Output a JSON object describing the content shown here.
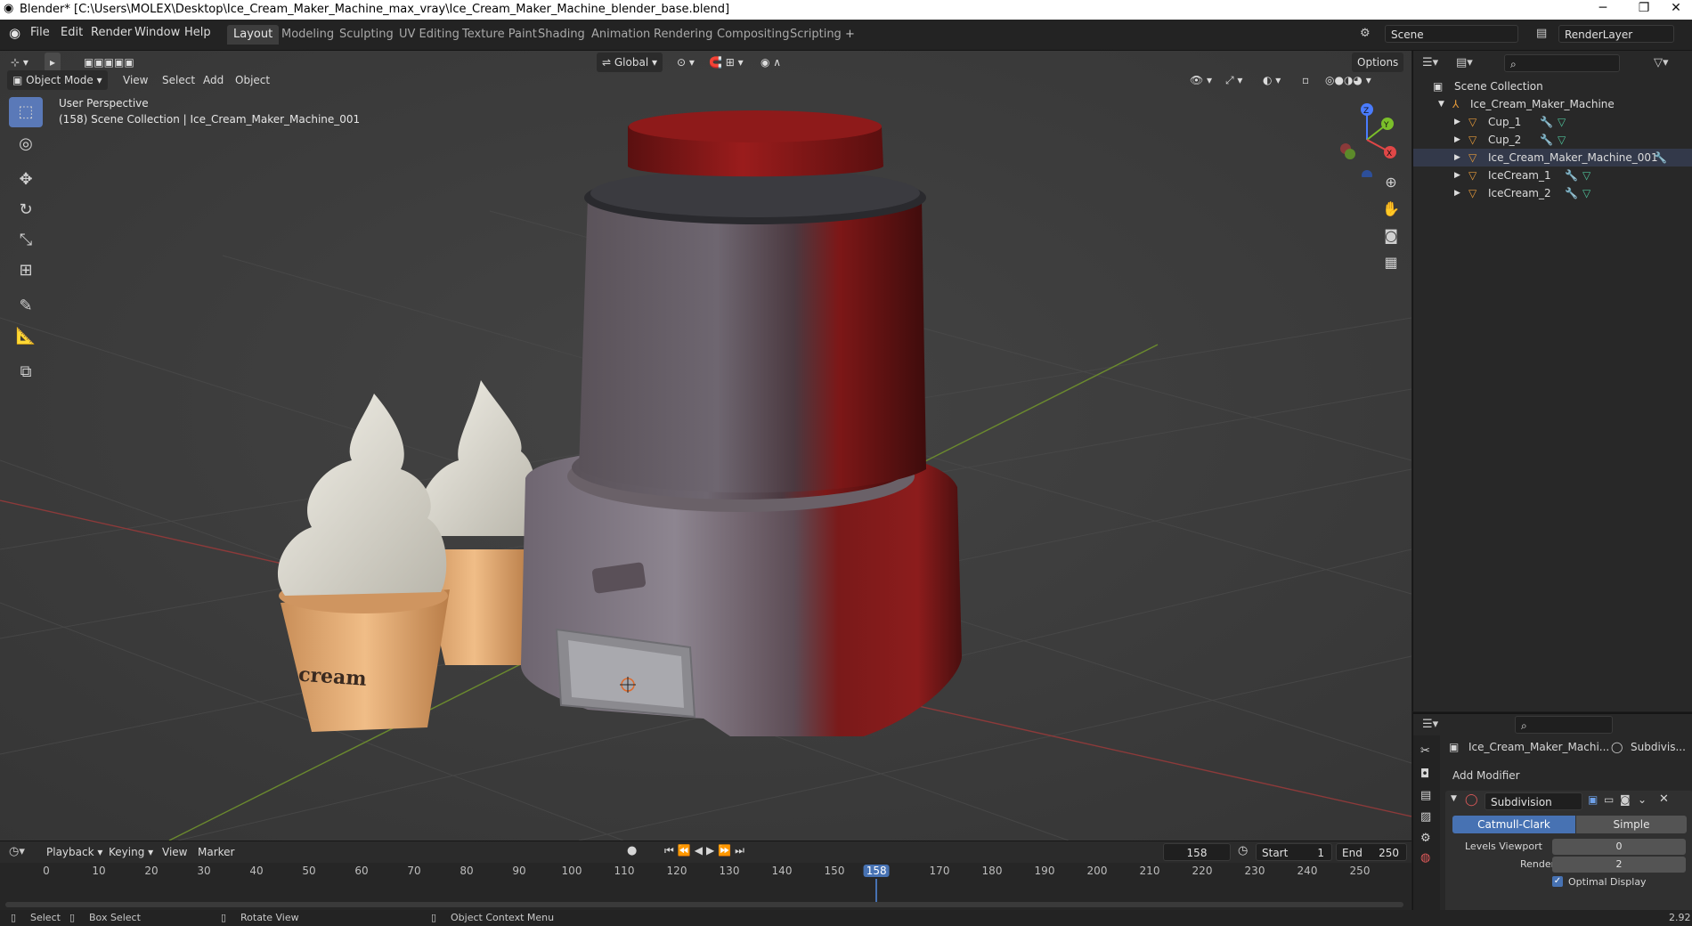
{
  "window": {
    "title": "Blender* [C:\\Users\\MOLEX\\Desktop\\Ice_Cream_Maker_Machine_max_vray\\Ice_Cream_Maker_Machine_blender_base.blend]",
    "minimize": "─",
    "restore": "❐",
    "close": "✕"
  },
  "menu": {
    "items": [
      "File",
      "Edit",
      "Render",
      "Window",
      "Help"
    ],
    "workspaces": [
      "Layout",
      "Modeling",
      "Sculpting",
      "UV Editing",
      "Texture Paint",
      "Shading",
      "Animation",
      "Rendering",
      "Compositing",
      "Scripting"
    ],
    "active_workspace": "Layout",
    "add_tab": "+",
    "scene": "Scene",
    "render_layer": "RenderLayer"
  },
  "viewport_header": {
    "mode": "Object Mode",
    "menus": [
      "View",
      "Select",
      "Add",
      "Object"
    ],
    "transform_orientation": "Global",
    "options": "Options"
  },
  "viewport": {
    "perspective": "User Perspective",
    "collection_info": "(158) Scene Collection | Ice_Cream_Maker_Machine_001",
    "cup_text": "cream",
    "gizmo_z": "Z",
    "gizmo_y": "Y",
    "gizmo_x": "X"
  },
  "outliner": {
    "root": "Scene Collection",
    "collection": "Ice_Cream_Maker_Machine",
    "objects": [
      "Cup_1",
      "Cup_2",
      "Ice_Cream_Maker_Machine_001",
      "IceCream_1",
      "IceCream_2"
    ]
  },
  "properties": {
    "object_name": "Ice_Cream_Maker_Machi...",
    "modifier_tab": "Subdivis...",
    "add_modifier": "Add Modifier",
    "modifier_name": "Subdivision",
    "type_catmull": "Catmull-Clark",
    "type_simple": "Simple",
    "levels_viewport_label": "Levels Viewport",
    "levels_viewport_value": "0",
    "render_label": "Render",
    "render_value": "2",
    "optimal_display": "Optimal Display"
  },
  "timeline": {
    "menus": [
      "Playback",
      "Keying",
      "View",
      "Marker"
    ],
    "current_frame": "158",
    "start_label": "Start",
    "start_value": "1",
    "end_label": "End",
    "end_value": "250",
    "ticks": [
      "0",
      "10",
      "20",
      "30",
      "40",
      "50",
      "60",
      "70",
      "80",
      "90",
      "100",
      "110",
      "120",
      "130",
      "140",
      "150",
      "158",
      "170",
      "180",
      "190",
      "200",
      "210",
      "220",
      "230",
      "240",
      "250"
    ]
  },
  "status": {
    "select": "Select",
    "box_select": "Box Select",
    "rotate_view": "Rotate View",
    "context_menu": "Object Context Menu",
    "version": "2.92"
  },
  "colors": {
    "accent": "#4772b3",
    "viewport_bg": "#3a3a3a",
    "machine_red": "#7a1414"
  }
}
